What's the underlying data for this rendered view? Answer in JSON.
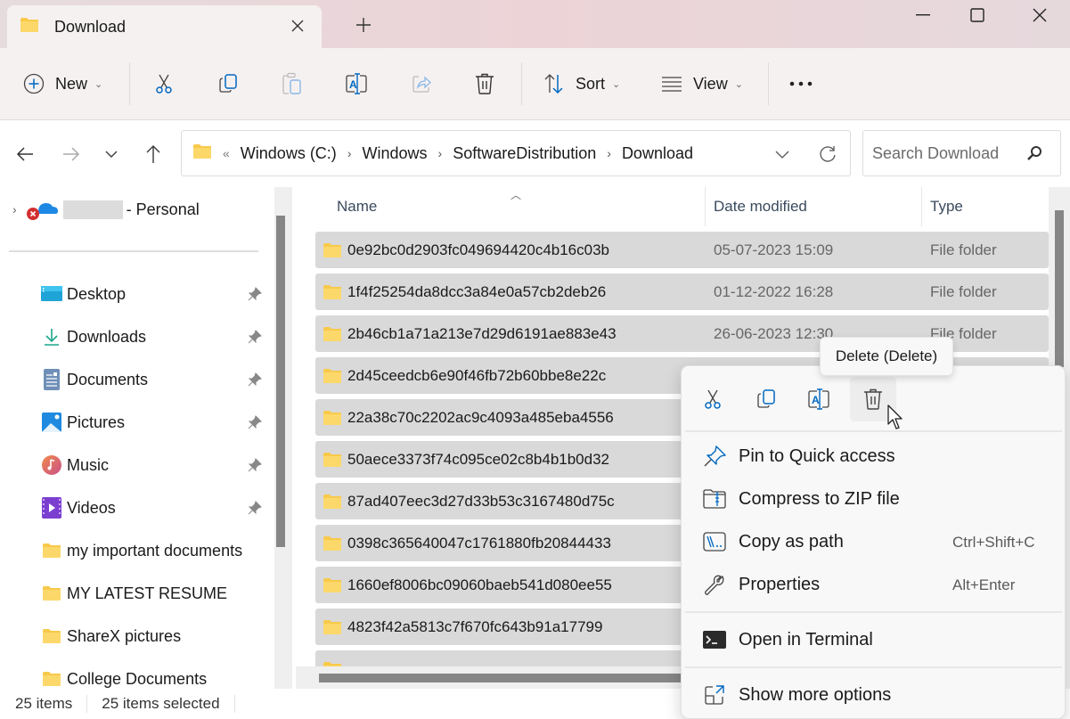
{
  "window": {
    "tab_title": "Download",
    "tab_icon": "folder-icon",
    "close_tab_icon": "close-icon",
    "new_tab_icon": "plus-icon",
    "controls": [
      "minimize-icon",
      "maximize-icon",
      "close-icon"
    ]
  },
  "toolbar": {
    "new_label": "New",
    "sort_label": "Sort",
    "view_label": "View",
    "icons": [
      "cut-icon",
      "copy-icon",
      "paste-icon",
      "rename-icon",
      "share-icon",
      "delete-icon",
      "more-icon"
    ]
  },
  "nav": {
    "breadcrumb_lead": "«",
    "breadcrumbs": [
      "Windows (C:)",
      "Windows",
      "SoftwareDistribution",
      "Download"
    ],
    "search_placeholder": "Search Download"
  },
  "sidebar": {
    "onedrive_label": "- Personal",
    "items": [
      {
        "label": "Desktop",
        "icon": "desktop-icon",
        "pinned": true
      },
      {
        "label": "Downloads",
        "icon": "download-icon",
        "pinned": true
      },
      {
        "label": "Documents",
        "icon": "documents-icon",
        "pinned": true
      },
      {
        "label": "Pictures",
        "icon": "pictures-icon",
        "pinned": true
      },
      {
        "label": "Music",
        "icon": "music-icon",
        "pinned": true
      },
      {
        "label": "Videos",
        "icon": "videos-icon",
        "pinned": true
      },
      {
        "label": "my important documents",
        "icon": "folder-icon",
        "pinned": false
      },
      {
        "label": "MY LATEST RESUME",
        "icon": "folder-icon",
        "pinned": false
      },
      {
        "label": "ShareX pictures",
        "icon": "folder-icon",
        "pinned": false
      },
      {
        "label": "College Documents",
        "icon": "folder-icon",
        "pinned": false
      }
    ]
  },
  "filelist": {
    "columns": {
      "name": "Name",
      "date": "Date modified",
      "type": "Type"
    },
    "rows": [
      {
        "name": "0e92bc0d2903fc049694420c4b16c03b",
        "date": "05-07-2023 15:09",
        "type": "File folder"
      },
      {
        "name": "1f4f25254da8dcc3a84e0a57cb2deb26",
        "date": "01-12-2022 16:28",
        "type": "File folder"
      },
      {
        "name": "2b46cb1a71a213e7d29d6191ae883e43",
        "date": "26-06-2023 12:30",
        "type": "File folder"
      },
      {
        "name": "2d45ceedcb6e90f46fb72b60bbe8e22c",
        "date": "",
        "type": ""
      },
      {
        "name": "22a38c70c2202ac9c4093a485eba4556",
        "date": "",
        "type": ""
      },
      {
        "name": "50aece3373f74c095ce02c8b4b1b0d32",
        "date": "",
        "type": ""
      },
      {
        "name": "87ad407eec3d27d33b53c3167480d75c",
        "date": "",
        "type": ""
      },
      {
        "name": "0398c365640047c1761880fb20844433",
        "date": "",
        "type": ""
      },
      {
        "name": "1660ef8006bc09060baeb541d080ee55",
        "date": "",
        "type": ""
      },
      {
        "name": "4823f42a5813c7f670fc643b91a17799",
        "date": "",
        "type": ""
      },
      {
        "name": "",
        "date": "",
        "type": ""
      }
    ]
  },
  "status": {
    "items": "25 items",
    "selected": "25 items selected"
  },
  "context_menu": {
    "tooltip": "Delete (Delete)",
    "quick_actions": [
      "cut-icon",
      "copy-icon",
      "rename-icon",
      "delete-icon"
    ],
    "items": [
      {
        "label": "Pin to Quick access",
        "shortcut": "",
        "icon": "pin-icon"
      },
      {
        "label": "Compress to ZIP file",
        "shortcut": "",
        "icon": "zip-icon"
      },
      {
        "label": "Copy as path",
        "shortcut": "Ctrl+Shift+C",
        "icon": "copy-path-icon"
      },
      {
        "label": "Properties",
        "shortcut": "Alt+Enter",
        "icon": "wrench-icon"
      },
      {
        "label": "Open in Terminal",
        "shortcut": "",
        "icon": "terminal-icon"
      },
      {
        "label": "Show more options",
        "shortcut": "",
        "icon": "more-options-icon"
      }
    ]
  },
  "colors": {
    "accent": "#0067c0",
    "selection": "#d9d9d9",
    "folder": "#f8c94a"
  }
}
